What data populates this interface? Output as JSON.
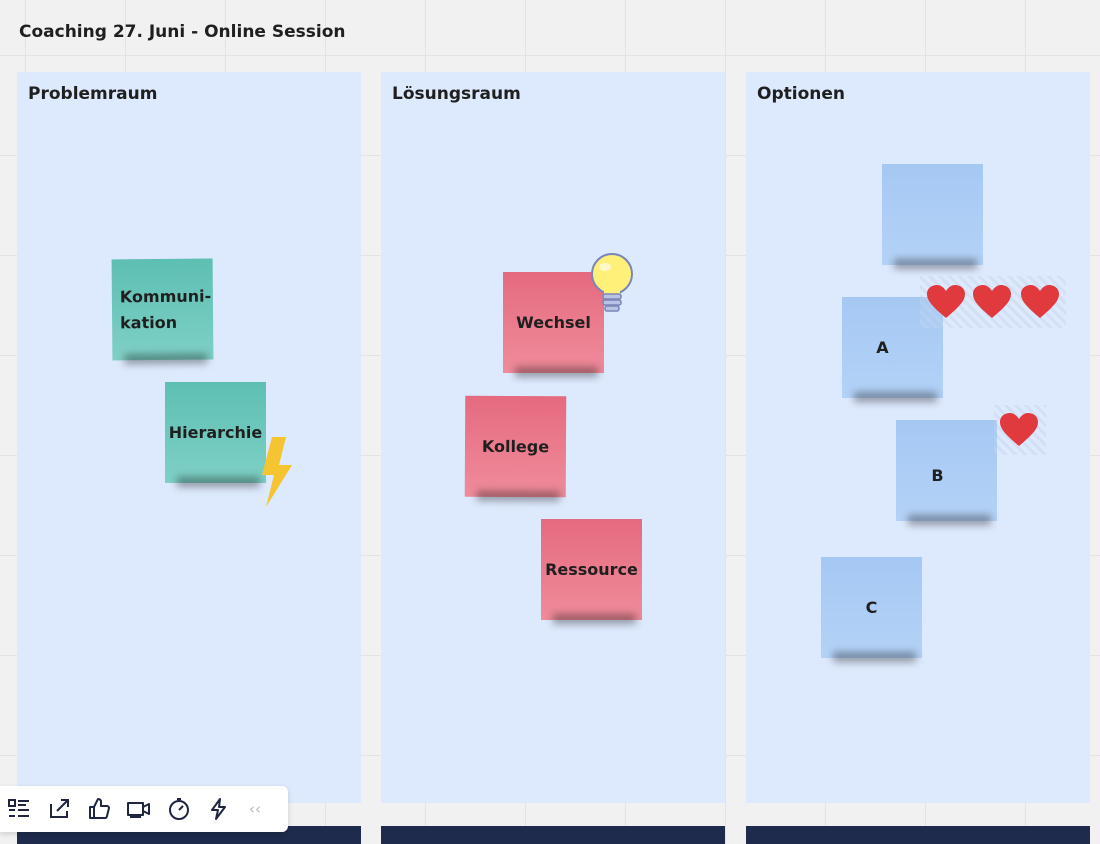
{
  "board": {
    "title": "Coaching 27. Juni - Online Session"
  },
  "columns": [
    {
      "title": "Problemraum"
    },
    {
      "title": "Lösungsraum"
    },
    {
      "title": "Optionen"
    }
  ],
  "stickies": {
    "kommunikation": "Kommuni- kation",
    "hierarchie": "Hierarchie",
    "wechsel": "Wechsel",
    "kollege": "Kollege",
    "ressource": "Ressource",
    "blank": "",
    "a": "A",
    "b": "B",
    "c": "C"
  },
  "colors": {
    "teal": "#6cc8bb",
    "pink": "#ea7a8c",
    "blue": "#abcdf5",
    "column_bg": "#dde9fd",
    "footer": "#1f2b4d",
    "heart": "#e03a3e",
    "bolt": "#f5c431"
  },
  "stamps": [
    "lightning-bolt-icon",
    "lightbulb-icon",
    "heart-icon"
  ],
  "toolbar": {
    "items": [
      "list-icon",
      "share-icon",
      "thumbs-up-icon",
      "video-camera-icon",
      "timer-icon",
      "lightning-icon"
    ],
    "collapse_label": "‹‹"
  }
}
